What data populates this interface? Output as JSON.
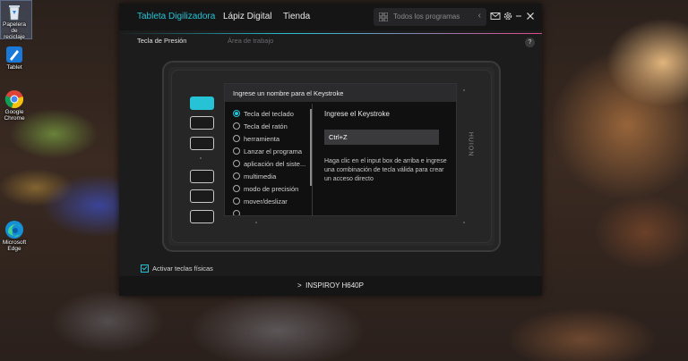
{
  "desktop": {
    "icons": [
      {
        "label": "Papelera de reciclaje",
        "icon": "recycle-bin-icon"
      },
      {
        "label": "Tablet",
        "icon": "tablet-app-icon"
      },
      {
        "label": "Google Chrome",
        "icon": "chrome-icon"
      },
      {
        "label": "Microsoft Edge",
        "icon": "edge-icon"
      }
    ]
  },
  "app": {
    "tabs": [
      {
        "label": "Tableta Digilizadora",
        "active": true
      },
      {
        "label": "Lápiz Digital",
        "active": false
      },
      {
        "label": "Tienda",
        "active": false
      }
    ],
    "programs": {
      "placeholder": "Todos los programas"
    },
    "subtabs": {
      "pressure": "Tecla de Presión",
      "work_area": "Área de trabajo"
    },
    "help_label": "?",
    "brand": "HUION",
    "dialog": {
      "title": "Ingrese un nombre para el Keystroke",
      "options": [
        {
          "label": "Tecla del teclado",
          "selected": true
        },
        {
          "label": "Tecla del ratón",
          "selected": false
        },
        {
          "label": "herramienta",
          "selected": false
        },
        {
          "label": "Lanzar el programa",
          "selected": false
        },
        {
          "label": "aplicación del siste...",
          "selected": false
        },
        {
          "label": "multimedia",
          "selected": false
        },
        {
          "label": "modo de precisión",
          "selected": false
        },
        {
          "label": "mover/deslizar",
          "selected": false
        }
      ],
      "keystroke_title": "Ingrese el Keystroke",
      "keystroke_value": "Ctrl+Z",
      "help_text": "Haga clic en el input box de arriba e ingrese una combinación de tecla válida para crear un acceso directo"
    },
    "physical_keys": {
      "label": "Activar teclas físicas",
      "checked": true
    },
    "device": {
      "name": "INSPIROY H640P",
      "chevron": ">"
    }
  },
  "colors": {
    "accent": "#25c3d5",
    "gradient_end": "#e0488a"
  }
}
